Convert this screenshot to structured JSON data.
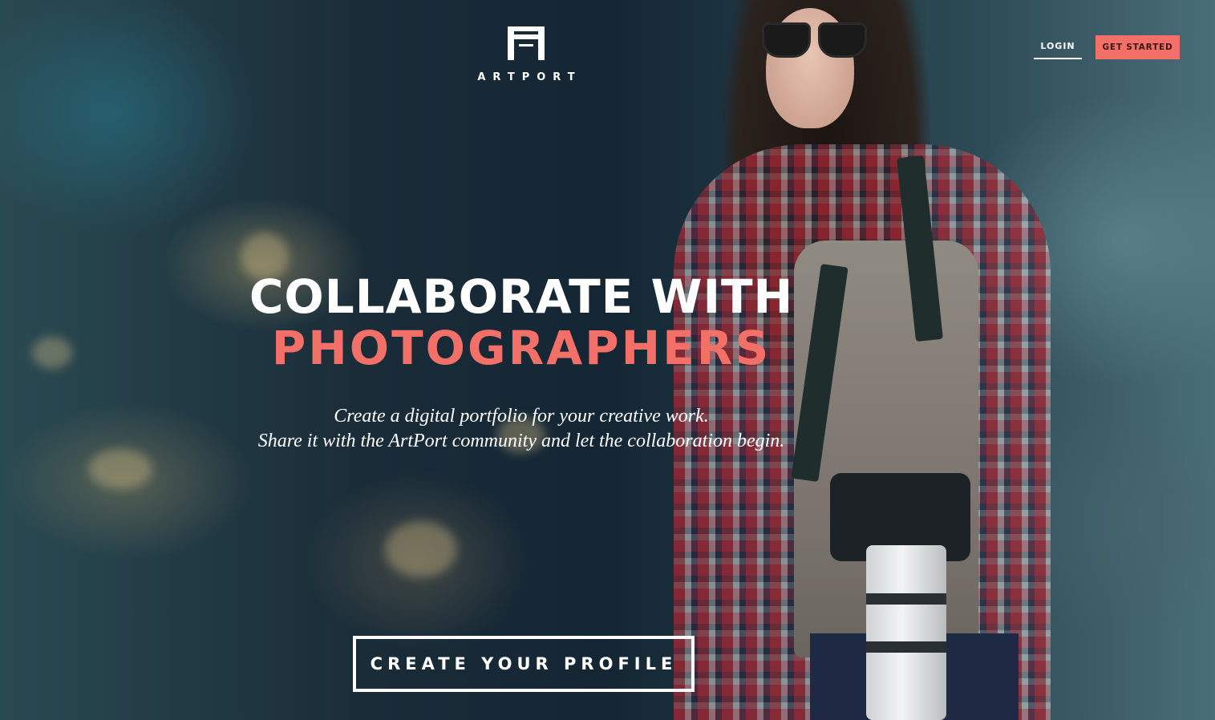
{
  "brand": {
    "name": "ARTPORT",
    "icon": "artport-logo-icon"
  },
  "nav": {
    "login_label": "LOGIN",
    "get_started_label": "GET STARTED"
  },
  "hero": {
    "headline_line1": "COLLABORATE WITH",
    "headline_line2": "PHOTOGRAPHERS",
    "subtext_line1": "Create a digital portfolio for your creative work.",
    "subtext_line2": "Share it with the ArtPort community and let the collaboration begin.",
    "cta_label": "CREATE YOUR PROFILE",
    "background_image": "woman-with-camera-photo"
  },
  "colors": {
    "accent": "#f37068",
    "text": "#ffffff"
  }
}
